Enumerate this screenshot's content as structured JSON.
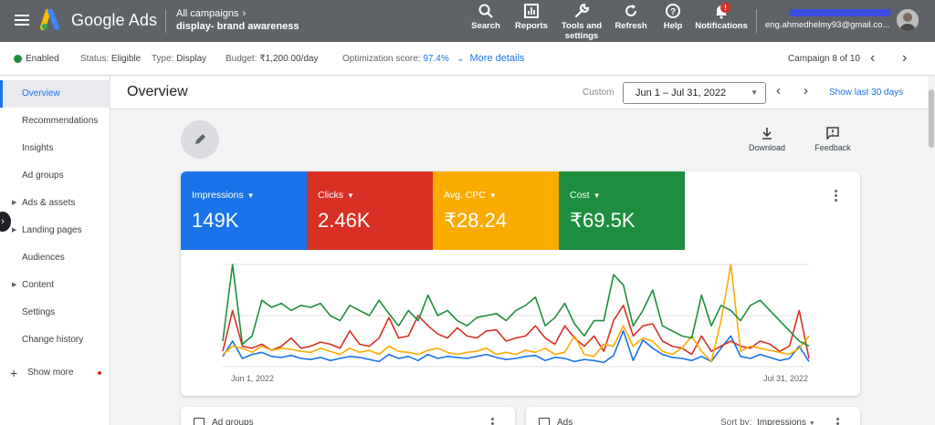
{
  "header": {
    "brand": "Google Ads",
    "breadcrumb": "All campaigns",
    "campaign": "display- brand awareness",
    "buttons": [
      {
        "label": "Search",
        "icon": "search-icon"
      },
      {
        "label": "Reports",
        "icon": "reports-icon"
      },
      {
        "label": "Tools and settings",
        "icon": "wrench-icon"
      },
      {
        "label": "Refresh",
        "icon": "refresh-icon"
      },
      {
        "label": "Help",
        "icon": "help-icon"
      },
      {
        "label": "Notifications",
        "icon": "bell-icon",
        "badge": "!"
      }
    ],
    "email": "eng.ahmedhelmy93@gmail.co..."
  },
  "status": {
    "enabled": "Enabled",
    "status_label": "Status:",
    "status_value": "Eligible",
    "type_label": "Type:",
    "type_value": "Display",
    "budget_label": "Budget:",
    "budget_value": "₹1,200.00/day",
    "opt_label": "Optimization score:",
    "opt_value": "97.4%",
    "more_details": "More details",
    "campaign_count": "Campaign 8 of 10"
  },
  "sidebar": {
    "items": [
      {
        "label": "Overview",
        "active": true,
        "caret": false
      },
      {
        "label": "Recommendations",
        "caret": false
      },
      {
        "label": "Insights",
        "caret": false
      },
      {
        "label": "Ad groups",
        "caret": false
      },
      {
        "label": "Ads & assets",
        "caret": true
      },
      {
        "label": "Landing pages",
        "caret": true
      },
      {
        "label": "Audiences",
        "caret": false
      },
      {
        "label": "Content",
        "caret": true
      },
      {
        "label": "Settings",
        "caret": false
      },
      {
        "label": "Change history",
        "caret": false
      }
    ],
    "show_more": "Show more"
  },
  "overview": {
    "title": "Overview",
    "custom": "Custom",
    "date_range": "Jun 1 – Jul 31, 2022",
    "show_last": "Show last 30 days",
    "download": "Download",
    "feedback": "Feedback"
  },
  "metrics": [
    {
      "label": "Impressions",
      "value": "149K",
      "color": "#1a73e8"
    },
    {
      "label": "Clicks",
      "value": "2.46K",
      "color": "#d93025"
    },
    {
      "label": "Avg. CPC",
      "value": "₹28.24",
      "color": "#f9ab00"
    },
    {
      "label": "Cost",
      "value": "₹69.5K",
      "color": "#1e8e3e"
    }
  ],
  "chart_data": {
    "type": "line",
    "x_start": "Jun 1, 2022",
    "x_end": "Jul 31, 2022",
    "ylim": [
      0,
      100
    ],
    "grid": true,
    "series": [
      {
        "name": "Impressions",
        "color": "#1a73e8",
        "values": [
          10,
          25,
          8,
          12,
          14,
          10,
          9,
          11,
          8,
          7,
          9,
          6,
          8,
          10,
          9,
          7,
          5,
          12,
          8,
          10,
          6,
          12,
          8,
          10,
          9,
          8,
          10,
          12,
          9,
          7,
          8,
          10,
          11,
          6,
          9,
          8,
          5,
          7,
          6,
          4,
          11,
          35,
          6,
          26,
          18,
          12,
          9,
          8,
          6,
          10,
          5,
          18,
          30,
          10,
          8,
          12,
          9,
          6,
          8,
          20,
          5
        ]
      },
      {
        "name": "Clicks",
        "color": "#d93025",
        "values": [
          15,
          55,
          20,
          18,
          22,
          16,
          20,
          28,
          18,
          20,
          24,
          22,
          18,
          35,
          22,
          20,
          28,
          48,
          28,
          30,
          50,
          40,
          32,
          28,
          38,
          30,
          28,
          35,
          36,
          25,
          28,
          30,
          40,
          28,
          22,
          40,
          28,
          20,
          30,
          15,
          45,
          60,
          30,
          40,
          42,
          25,
          20,
          18,
          12,
          30,
          15,
          20,
          25,
          20,
          18,
          25,
          22,
          15,
          20,
          55,
          8
        ]
      },
      {
        "name": "Avg. CPC",
        "color": "#f9ab00",
        "values": [
          12,
          20,
          18,
          14,
          20,
          16,
          18,
          17,
          15,
          14,
          18,
          15,
          12,
          18,
          14,
          16,
          12,
          20,
          15,
          14,
          12,
          16,
          18,
          14,
          12,
          14,
          15,
          18,
          12,
          14,
          12,
          16,
          14,
          18,
          12,
          14,
          30,
          12,
          10,
          22,
          20,
          40,
          20,
          28,
          25,
          15,
          12,
          18,
          30,
          15,
          5,
          45,
          100,
          15,
          20,
          18,
          16,
          14,
          12,
          18,
          30
        ]
      },
      {
        "name": "Cost",
        "color": "#1e8e3e",
        "values": [
          25,
          100,
          22,
          30,
          65,
          58,
          62,
          55,
          60,
          58,
          62,
          50,
          45,
          60,
          55,
          50,
          65,
          52,
          40,
          55,
          45,
          70,
          50,
          55,
          45,
          40,
          48,
          50,
          52,
          45,
          55,
          60,
          68,
          40,
          48,
          62,
          42,
          30,
          45,
          45,
          90,
          80,
          40,
          55,
          75,
          40,
          35,
          30,
          28,
          70,
          40,
          60,
          55,
          45,
          60,
          65,
          55,
          45,
          35,
          25,
          20
        ]
      }
    ]
  },
  "bottom_cards": {
    "left_title": "Ad groups",
    "right_title": "Ads",
    "sort_label": "Sort by:",
    "sort_value": "Impressions"
  }
}
